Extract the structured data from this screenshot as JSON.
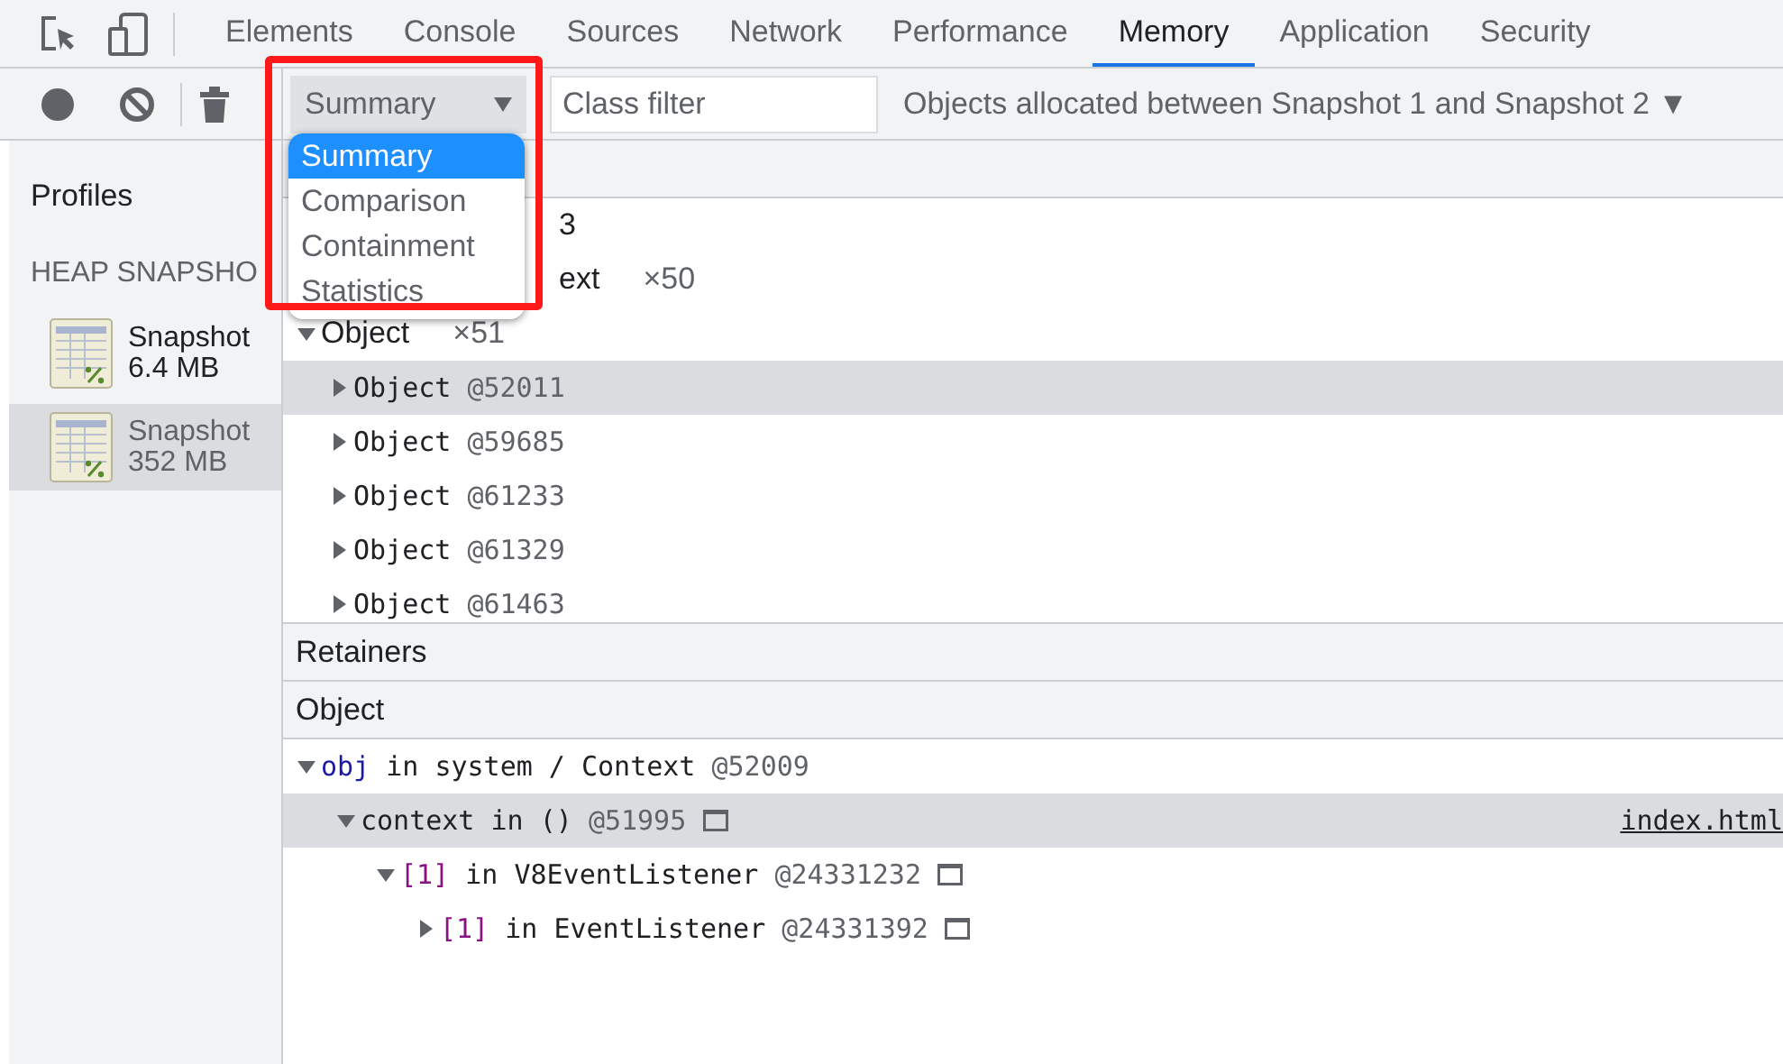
{
  "tabs": [
    {
      "label": "Elements",
      "selected": false
    },
    {
      "label": "Console",
      "selected": false
    },
    {
      "label": "Sources",
      "selected": false
    },
    {
      "label": "Network",
      "selected": false
    },
    {
      "label": "Performance",
      "selected": false
    },
    {
      "label": "Memory",
      "selected": true
    },
    {
      "label": "Application",
      "selected": false
    },
    {
      "label": "Security",
      "selected": false
    }
  ],
  "toolbar": {
    "view_select": "Summary",
    "class_filter": {
      "placeholder": "Class filter"
    },
    "range_select": "Objects allocated between Snapshot 1 and Snapshot 2 ▼"
  },
  "view_menu": [
    {
      "label": "Summary",
      "selected": true
    },
    {
      "label": "Comparison",
      "selected": false
    },
    {
      "label": "Containment",
      "selected": false
    },
    {
      "label": "Statistics",
      "selected": false
    }
  ],
  "sidebar": {
    "title": "Profiles",
    "section": "HEAP SNAPSHO",
    "snapshots": [
      {
        "name": "Snapshot",
        "size": "6.4 MB",
        "selected": false
      },
      {
        "name": "Snapshot",
        "size": "352 MB",
        "selected": true
      }
    ]
  },
  "summary_rows": [
    {
      "kind": "partial",
      "text": "3"
    },
    {
      "kind": "partial",
      "text": "ext",
      "count": "×50"
    },
    {
      "kind": "group",
      "name": "Object",
      "count": "×51",
      "expanded": true,
      "children": [
        {
          "name": "Object",
          "id": "@52011",
          "selected": true
        },
        {
          "name": "Object",
          "id": "@59685",
          "selected": false
        },
        {
          "name": "Object",
          "id": "@61233",
          "selected": false
        },
        {
          "name": "Object",
          "id": "@61329",
          "selected": false
        },
        {
          "name": "Object",
          "id": "@61463",
          "selected": false
        }
      ]
    }
  ],
  "retainers": {
    "title": "Retainers",
    "column": "Object",
    "rows": [
      {
        "kind": "property",
        "name": "obj",
        "text": "in system / Context",
        "id": "@52009",
        "expanded": true,
        "selected": false,
        "icon": false,
        "children": [
          {
            "kind": "plain",
            "name": "context",
            "text": "in ()",
            "id": "@51995",
            "expanded": true,
            "selected": true,
            "icon": true,
            "link": "index.html",
            "children": [
              {
                "kind": "element",
                "name": "[1]",
                "text": "in V8EventListener",
                "id": "@24331232",
                "expanded": true,
                "selected": false,
                "icon": true,
                "children": [
                  {
                    "kind": "element",
                    "name": "[1]",
                    "text": "in EventListener",
                    "id": "@24331392",
                    "expanded": false,
                    "selected": false,
                    "icon": true
                  }
                ]
              }
            ]
          }
        ]
      }
    ]
  }
}
